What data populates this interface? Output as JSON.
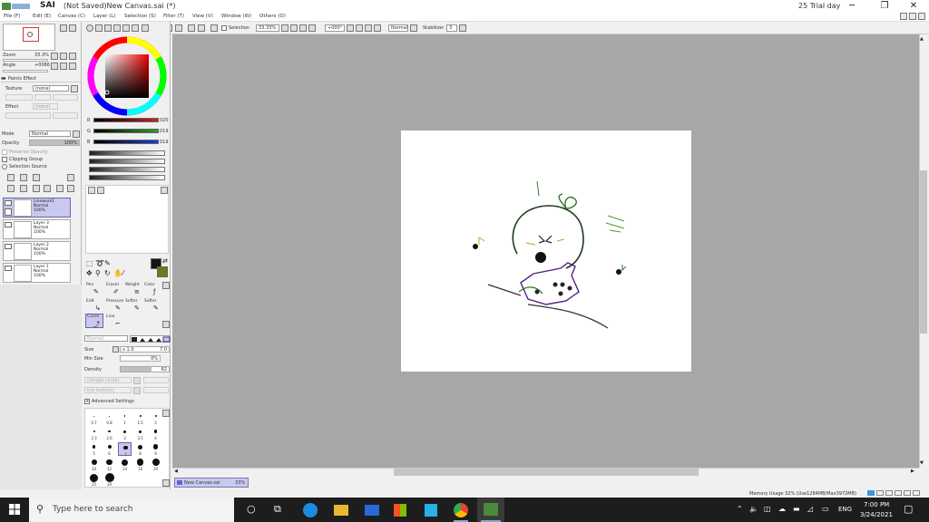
{
  "titlebar": {
    "app_name": "SAI",
    "title": "(Not Saved)New Canvas.sai (*)",
    "trial": "25 Trial day"
  },
  "menu": [
    "File (F)",
    "Edit (E)",
    "Canvas (C)",
    "Layer (L)",
    "Selection (S)",
    "Filter (T)",
    "View (V)",
    "Window (W)",
    "Others (O)"
  ],
  "toolbar": {
    "selection_label": "Selection",
    "zoom": "33.33%",
    "angle": "+000°",
    "blend": "Normal",
    "stabilizer_label": "Stabilizer",
    "stabilizer_value": "3"
  },
  "navigator": {
    "zoom_label": "Zoom",
    "zoom_value": "33.3%",
    "angle_label": "Angle",
    "angle_value": "+0086"
  },
  "paint_effect": {
    "header": "Paints Effect",
    "texture_label": "Texture",
    "texture_value": "(none)",
    "effect_label": "Effect",
    "effect_value": "(none)"
  },
  "layer_props": {
    "mode_label": "Mode",
    "mode_value": "Normal",
    "opacity_label": "Opacity",
    "opacity_value": "100%",
    "preserve_opacity": "Preserve Opacity",
    "clipping_group": "Clipping Group",
    "selection_source": "Selection Source"
  },
  "layers": [
    {
      "name": "Linework1",
      "mode": "Normal",
      "opacity": "100%",
      "selected": true
    },
    {
      "name": "Layer 3",
      "mode": "Normal",
      "opacity": "100%",
      "selected": false
    },
    {
      "name": "Layer 2",
      "mode": "Normal",
      "opacity": "100%",
      "selected": false
    },
    {
      "name": "Layer 1",
      "mode": "Normal",
      "opacity": "100%",
      "selected": false
    }
  ],
  "color": {
    "r_label": "R",
    "r_value": "020",
    "g_label": "G",
    "g_value": "019",
    "b_label": "B",
    "b_value": "019",
    "red": "#d22020",
    "green": "#2ca02c",
    "blue": "#1f3fd2",
    "primary": "#141414",
    "secondary": "#6b7a1a"
  },
  "tools": {
    "row1": [
      "Pen",
      "Eraser",
      "Weight",
      "Color"
    ],
    "row2": [
      "Edit",
      "Pressure",
      "Softer",
      "Softer"
    ],
    "row3": [
      "Curve",
      "Line"
    ]
  },
  "brush": {
    "blend_value": "Normal",
    "size_label": "Size",
    "size_mult": "x 1.0",
    "size_value": "7.0",
    "min_size_label": "Min Size",
    "min_size_value": "0%",
    "density_label": "Density",
    "density_value": "62",
    "shape_value": "(simple circle)",
    "texture_value": "(no texture)",
    "advanced": "Advanced Settings"
  },
  "brush_sizes": {
    "row1": [
      "0.7",
      "0.8",
      "1",
      "1.5",
      "2"
    ],
    "row2": [
      "2.3",
      "2.6",
      "3",
      "3.5",
      "4"
    ],
    "row3": [
      "5",
      "6",
      "7",
      "8",
      "9"
    ],
    "row4": [
      "10",
      "12",
      "14",
      "16",
      "20"
    ],
    "row5": [
      "25",
      "30"
    ]
  },
  "document_tab": {
    "name": "New Canvas.sai",
    "zoom": "33%"
  },
  "status": {
    "memory": "Memory Usage 32% (Use1284MB/Max3972MB)"
  },
  "taskbar": {
    "search_placeholder": "Type here to search",
    "lang": "ENG",
    "time": "7:00 PM",
    "date": "3/24/2021"
  }
}
